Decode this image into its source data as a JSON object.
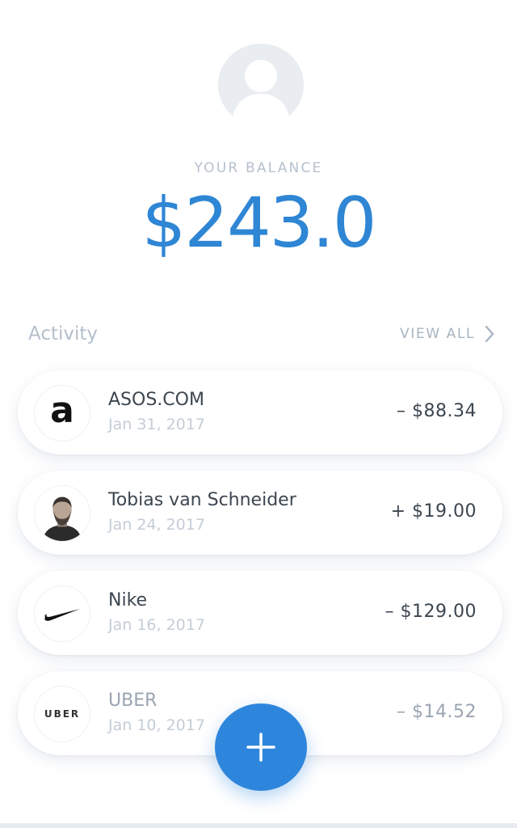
{
  "profile": {
    "avatar_icon": "user-silhouette-icon"
  },
  "balance": {
    "label": "YOUR BALANCE",
    "amount": "$243.0",
    "accent_color": "#2e86d4"
  },
  "activity": {
    "title": "Activity",
    "view_all_label": "VIEW ALL",
    "view_all_icon": "chevron-right-icon",
    "transactions": [
      {
        "name": "ASOS.COM",
        "date": "Jan 31, 2017",
        "amount": "– $88.34",
        "logo": "asos-logo"
      },
      {
        "name": "Tobias van Schneider",
        "date": "Jan 24, 2017",
        "amount": "+ $19.00",
        "logo": "person-photo"
      },
      {
        "name": "Nike",
        "date": "Jan 16, 2017",
        "amount": "– $129.00",
        "logo": "nike-swoosh-logo"
      },
      {
        "name": "UBER",
        "date": "Jan 10, 2017",
        "amount": "– $14.52",
        "logo": "uber-logo",
        "logo_text": "UBER"
      }
    ]
  },
  "fab": {
    "icon": "plus-icon",
    "color": "#2e86dc"
  }
}
